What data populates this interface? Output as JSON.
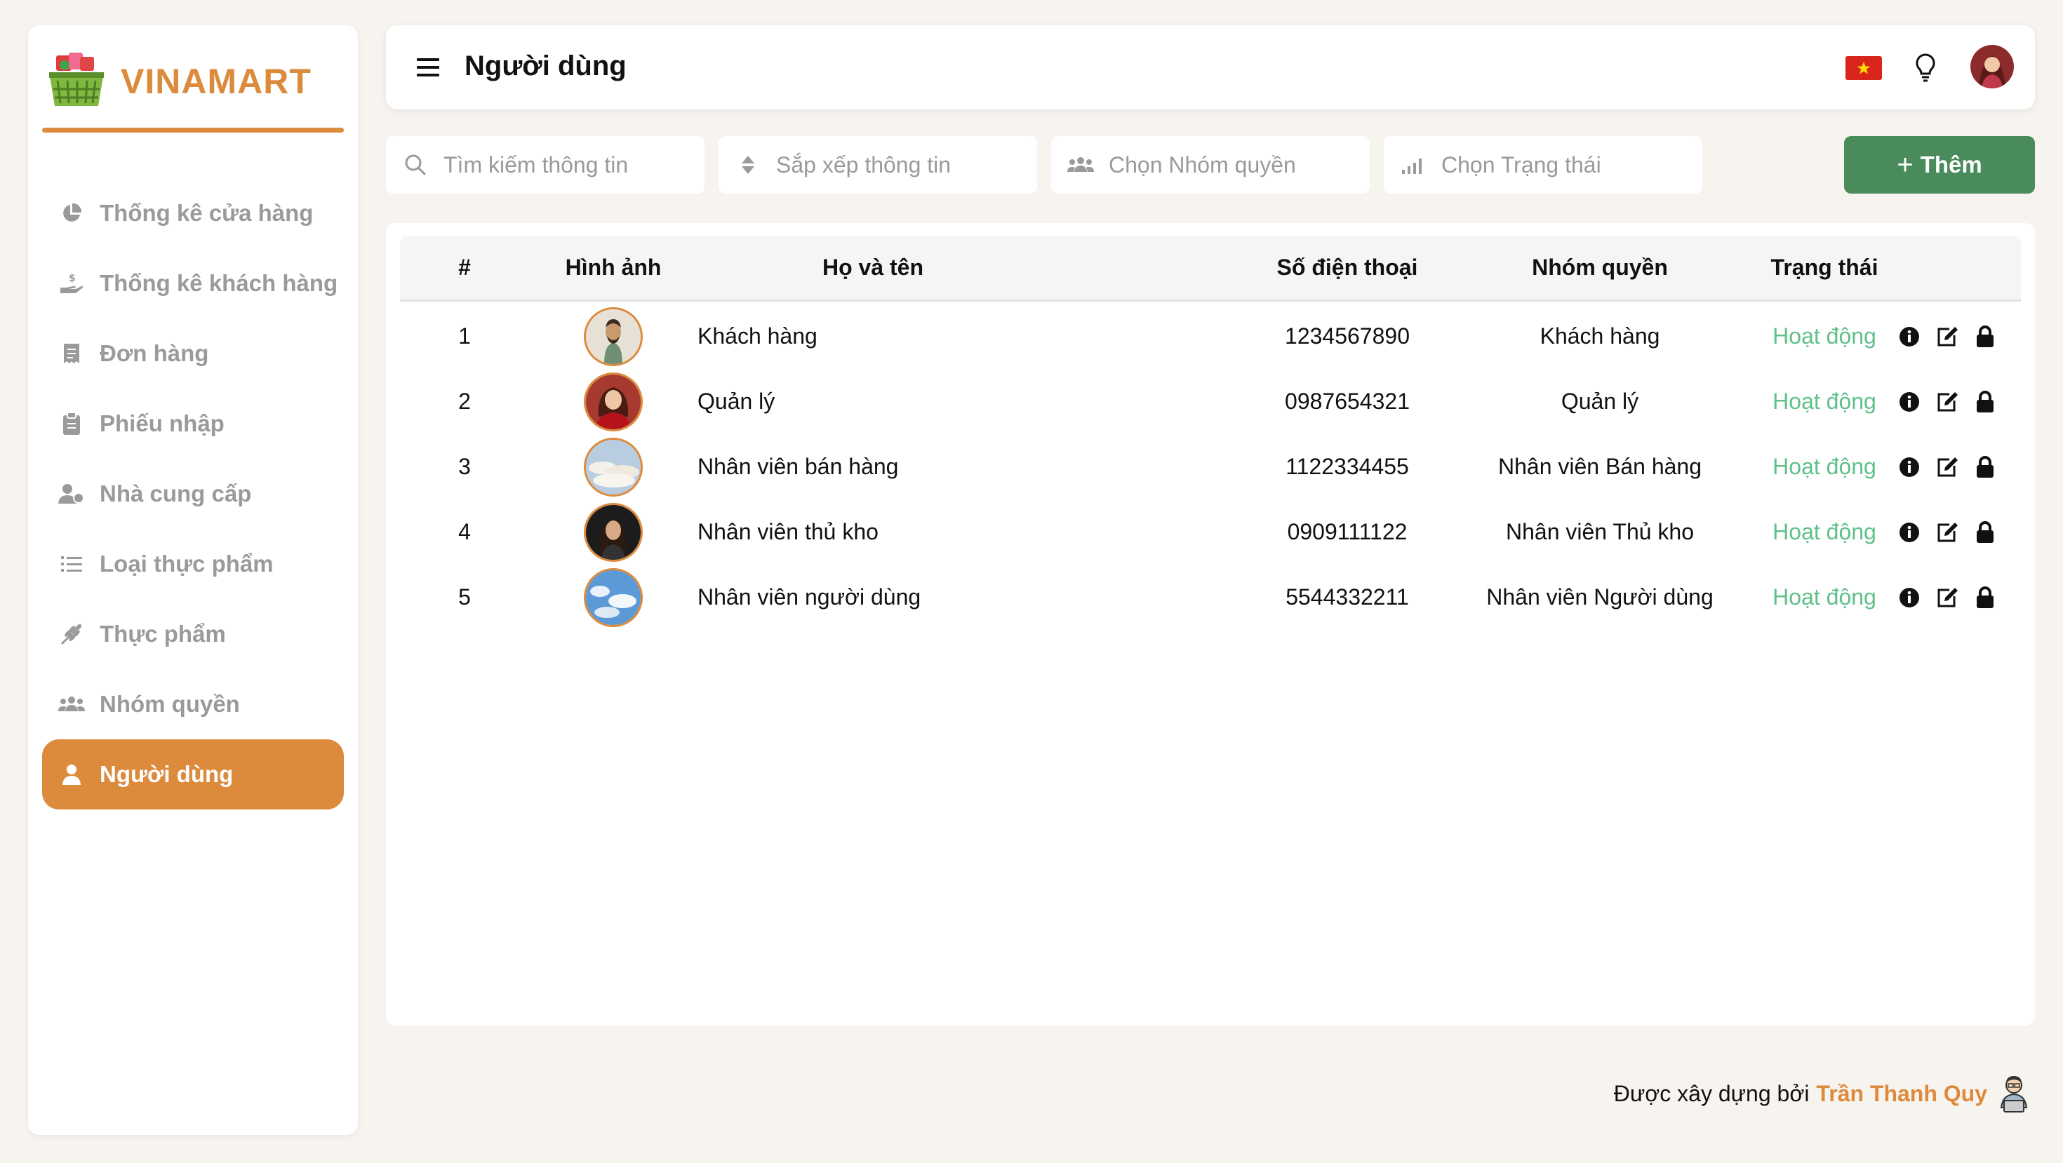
{
  "brand": {
    "name": "VINAMART",
    "accent": "#dc8b3c"
  },
  "sidebar": {
    "items": [
      {
        "label": "Thống kê cửa hàng",
        "icon": "pie-chart-icon",
        "active": false
      },
      {
        "label": "Thống kê khách hàng",
        "icon": "hand-money-icon",
        "active": false
      },
      {
        "label": "Đơn hàng",
        "icon": "receipt-icon",
        "active": false
      },
      {
        "label": "Phiếu nhập",
        "icon": "clipboard-icon",
        "active": false
      },
      {
        "label": "Nhà cung cấp",
        "icon": "user-group-icon",
        "active": false
      },
      {
        "label": "Loại thực phẩm",
        "icon": "list-icon",
        "active": false
      },
      {
        "label": "Thực phẩm",
        "icon": "wheat-icon",
        "active": false
      },
      {
        "label": "Nhóm quyền",
        "icon": "users-icon",
        "active": false
      },
      {
        "label": "Người dùng",
        "icon": "user-icon",
        "active": true
      }
    ]
  },
  "header": {
    "title": "Người dùng",
    "flag": "vietnam-flag-icon"
  },
  "toolbar": {
    "search_placeholder": "Tìm kiếm thông tin",
    "sort_placeholder": "Sắp xếp thông tin",
    "group_placeholder": "Chọn Nhóm quyền",
    "status_placeholder": "Chọn Trạng thái",
    "add_label": "Thêm",
    "add_color": "#4a8b5c"
  },
  "table": {
    "headers": {
      "num": "#",
      "image": "Hình ảnh",
      "name": "Họ và tên",
      "phone": "Số điện thoại",
      "group": "Nhóm quyền",
      "status": "Trạng thái"
    },
    "rows": [
      {
        "num": "1",
        "name": "Khách hàng",
        "phone": "1234567890",
        "group": "Khách hàng",
        "status": "Hoạt động"
      },
      {
        "num": "2",
        "name": "Quản lý",
        "phone": "0987654321",
        "group": "Quản lý",
        "status": "Hoạt động"
      },
      {
        "num": "3",
        "name": "Nhân viên bán hàng",
        "phone": "1122334455",
        "group": "Nhân viên Bán hàng",
        "status": "Hoạt động"
      },
      {
        "num": "4",
        "name": "Nhân viên thủ kho",
        "phone": "0909111122",
        "group": "Nhân viên Thủ kho",
        "status": "Hoạt động"
      },
      {
        "num": "5",
        "name": "Nhân viên người dùng",
        "phone": "5544332211",
        "group": "Nhân viên Người dùng",
        "status": "Hoạt động"
      }
    ],
    "status_color": "#5fc08a"
  },
  "footer": {
    "prefix": "Được xây dựng bởi",
    "author": "Trần Thanh Quy"
  }
}
